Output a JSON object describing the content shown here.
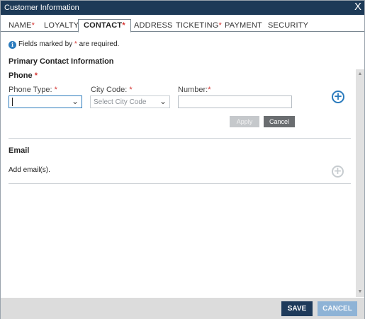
{
  "window": {
    "title": "Customer Information",
    "close_glyph": "X"
  },
  "tabs": [
    {
      "label": "NAME",
      "required": "*"
    },
    {
      "label": "LOYALTY",
      "required": ""
    },
    {
      "label": "CONTACT",
      "required": "*"
    },
    {
      "label": "ADDRESS",
      "required": ""
    },
    {
      "label": "TICKETING",
      "required": "*"
    },
    {
      "label": "PAYMENT",
      "required": ""
    },
    {
      "label": "SECURITY",
      "required": ""
    }
  ],
  "active_tab": "CONTACT",
  "notice": {
    "before": "Fields marked by",
    "star": "*",
    "after": "are required."
  },
  "primary_contact": {
    "title": "Primary Contact Information"
  },
  "phone": {
    "title": "Phone",
    "title_star": "*",
    "phone_type_label": "Phone Type:",
    "phone_type_star": "*",
    "phone_type_value": "",
    "city_code_label": "City Code:",
    "city_code_star": "*",
    "city_code_placeholder": "Select City Code",
    "number_label": "Number:",
    "number_star": "*",
    "number_value": "",
    "apply_label": "Apply",
    "cancel_label": "Cancel"
  },
  "email": {
    "title": "Email",
    "add_text": "Add email(s)."
  },
  "footer": {
    "save_label": "SAVE",
    "cancel_label": "CANCEL"
  },
  "colors": {
    "titlebar": "#1d3a57",
    "accent": "#2b7bbd",
    "required": "#d3322f",
    "save_button": "#1e3a5a",
    "cancel_button": "#8eb3d6"
  },
  "icons": {
    "close": "close-icon",
    "info": "info-icon",
    "add_phone": "add-circle-icon",
    "add_email": "add-circle-icon",
    "dropdown": "chevron-down-icon"
  }
}
